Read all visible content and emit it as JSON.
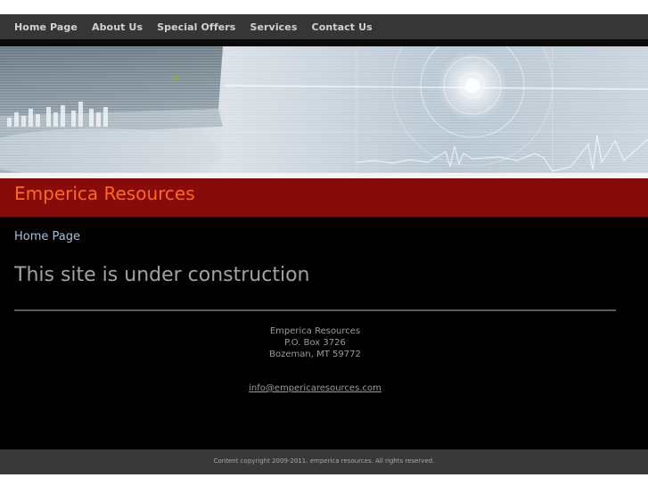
{
  "nav": {
    "items": [
      {
        "label": "Home Page"
      },
      {
        "label": "About Us"
      },
      {
        "label": "Special Offers"
      },
      {
        "label": "Services"
      },
      {
        "label": "Contact Us"
      }
    ]
  },
  "header": {
    "site_title": "Emperica Resources"
  },
  "main": {
    "breadcrumb": "Home Page",
    "heading": "This site is under construction",
    "address": {
      "line1": "Emperica Resources",
      "line2": "P.O. Box 3726",
      "line3": "Bozeman, MT 59772"
    },
    "email": "info@empericaresources.com"
  },
  "footer": {
    "copyright": "Content copyright 2009-2011. emperica resources. All rights reserved."
  },
  "colors": {
    "nav_bg": "#363636",
    "title_bar": "#880b0b",
    "title_text": "#ff6a16",
    "content_bg": "#000000",
    "footer_bg": "#393939"
  }
}
